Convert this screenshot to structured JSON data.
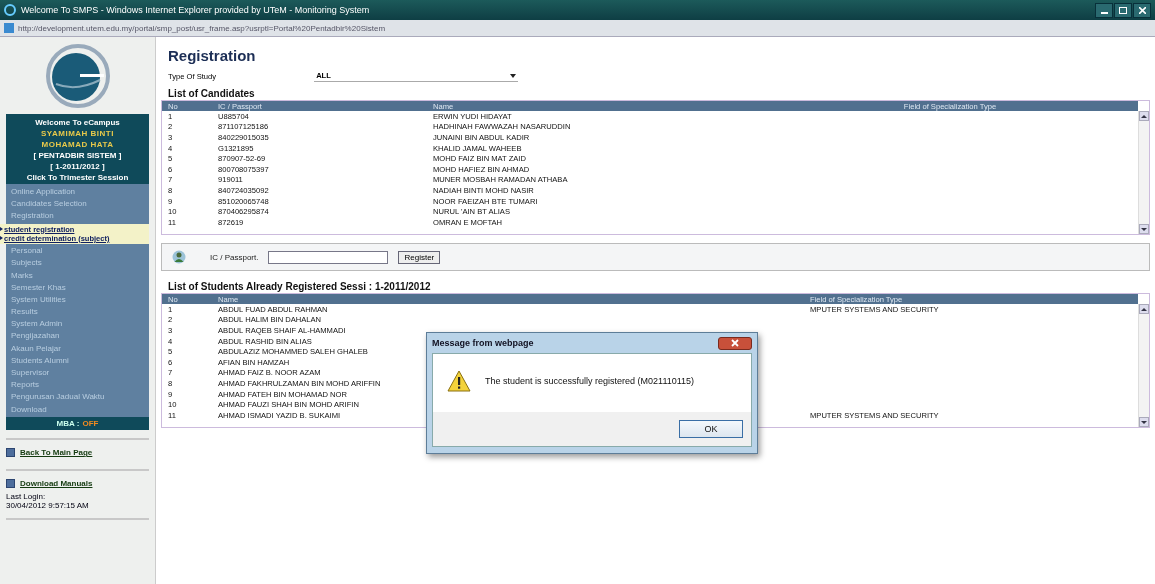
{
  "window": {
    "title": "Welcome To SMPS - Windows Internet Explorer provided by UTeM - Monitoring System",
    "address": "http://development.utem.edu.my/portal/smp_post/usr_frame.asp?usrptl=Portal%20Pentadbir%20Sistem"
  },
  "sidebar": {
    "welcome": "Welcome To eCampus",
    "user": [
      "SYAMIMAH BINTI",
      "MOHAMAD HATA"
    ],
    "role": "[ PENTADBIR SISTEM ]",
    "session": "[ 1-2011/2012 ]",
    "session_link": "Click To Trimester Session",
    "menu_top": [
      "Online Application",
      "Candidates Selection",
      "Registration"
    ],
    "sub_links": [
      "student registration",
      "credit determination (subject)"
    ],
    "menu": [
      "Personal",
      "Subjects",
      "Marks",
      "Semester Khas",
      "System Utilities",
      "Results",
      "System Admin",
      "Pengijazahan",
      "Akaun Pelajar",
      "Students Alumni",
      "Supervisor",
      "Reports",
      "Pengurusan Jadual Waktu",
      "Download"
    ],
    "mba": {
      "label": "MBA :",
      "value": "OFF"
    },
    "back_link": "Back To Main Page",
    "manuals_link": "Download Manuals",
    "last_login_label": "Last Login:",
    "last_login": "30/04/2012 9:57:15 AM"
  },
  "page": {
    "heading": "Registration",
    "study_label": "Type Of Study",
    "study_value": "ALL"
  },
  "candidates": {
    "kind": "candidates",
    "title": "List of Candidates",
    "columns": [
      "No",
      "IC / Passport",
      "Name",
      "Field of Specialization Type"
    ],
    "rows": [
      {
        "no": "1",
        "ic": "U885704",
        "name": "ERWIN YUDI HIDAYAT"
      },
      {
        "no": "2",
        "ic": "871107125186",
        "name": "HADHINAH FAWWAZAH NASARUDDIN"
      },
      {
        "no": "3",
        "ic": "840229015035",
        "name": "JUNAINI BIN ABDUL KADIR"
      },
      {
        "no": "4",
        "ic": "G1321895",
        "name": "KHALID JAMAL WAHEEB"
      },
      {
        "no": "5",
        "ic": "870907-52-69",
        "name": "MOHD FAIZ BIN MAT ZAID"
      },
      {
        "no": "6",
        "ic": "800708075397",
        "name": "MOHD HAFIEZ BIN AHMAD"
      },
      {
        "no": "7",
        "ic": "919011",
        "name": "MUNER MOSBAH RAMADAN ATHABA"
      },
      {
        "no": "8",
        "ic": "840724035092",
        "name": "NADIAH BINTI MOHD NASIR"
      },
      {
        "no": "9",
        "ic": "851020065748",
        "name": "NOOR FAEIZAH BTE TUMARI"
      },
      {
        "no": "10",
        "ic": "870406295874",
        "name": "NURUL 'AIN BT ALIAS"
      },
      {
        "no": "11",
        "ic": "872619",
        "name": "OMRAN E MOFTAH"
      }
    ]
  },
  "register_form": {
    "label": "IC / Passport.",
    "button": "Register"
  },
  "registered": {
    "kind": "registered",
    "title": "List of Students Already Registered Sessi : 1-2011/2012",
    "columns": [
      "No",
      "Name",
      "Field of Specialization Type"
    ],
    "rows": [
      {
        "no": "1",
        "name": "ABDUL FUAD ABDUL RAHMAN",
        "field": "MPUTER SYSTEMS AND SECURITY"
      },
      {
        "no": "2",
        "name": "ABDUL HALIM BIN DAHALAN"
      },
      {
        "no": "3",
        "name": "ABDUL RAQEB SHAIF AL-HAMMADI"
      },
      {
        "no": "4",
        "name": "ABDUL RASHID BIN ALIAS"
      },
      {
        "no": "5",
        "name": "ABDULAZIZ MOHAMMED SALEH GHALEB"
      },
      {
        "no": "6",
        "name": "AFIAN BIN HAMZAH"
      },
      {
        "no": "7",
        "name": "AHMAD FAIZ B. NOOR AZAM"
      },
      {
        "no": "8",
        "name": "AHMAD FAKHRULZAMAN BIN MOHD ARIFFIN"
      },
      {
        "no": "9",
        "name": "AHMAD FATEH BIN MOHAMAD NOR"
      },
      {
        "no": "10",
        "name": "AHMAD FAUZI SHAH BIN MOHD ARIFIN"
      },
      {
        "no": "11",
        "name": "AHMAD ISMADI YAZID B. SUKAIMI",
        "field": "MPUTER SYSTEMS AND SECURITY"
      }
    ]
  },
  "dialog": {
    "title": "Message from webpage",
    "message": "The student is successfully registered (M021110115)",
    "button": "OK"
  }
}
